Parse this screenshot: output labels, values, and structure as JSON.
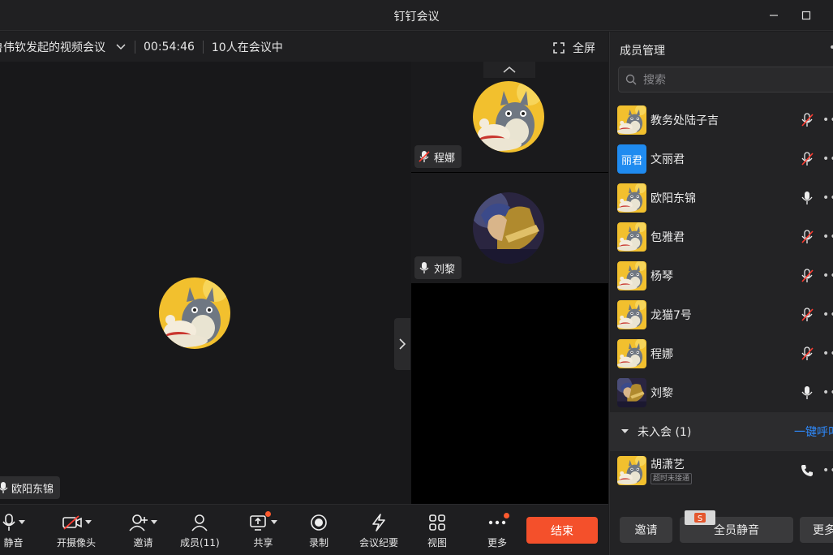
{
  "window": {
    "title": "钉钉会议"
  },
  "meeting": {
    "title": "鲁伟钦发起的视频会议",
    "duration": "00:54:46",
    "participants_status": "10人在会议中",
    "fullscreen_label": "全屏"
  },
  "stage": {
    "speaker_name": "欧阳东锦"
  },
  "gallery": [
    {
      "name": "程娜",
      "muted": true,
      "avatar": "totoro"
    },
    {
      "name": "刘黎",
      "muted": false,
      "avatar": "warrior"
    }
  ],
  "toolbar": {
    "mute_label": "静音",
    "camera_label": "开摄像头",
    "invite_label": "邀请",
    "members_label": "成员(11)",
    "share_label": "共享",
    "record_label": "录制",
    "minutes_label": "会议纪要",
    "view_label": "视图",
    "more_label": "更多",
    "end_label": "结束"
  },
  "panel": {
    "title": "成员管理",
    "more_glyph": "•",
    "search_placeholder": "搜索",
    "members": [
      {
        "name": "教务处陆子吉",
        "muted": true,
        "avatar": "totoro"
      },
      {
        "name": "文丽君",
        "muted": true,
        "avatar": "text",
        "avatar_text": "丽君"
      },
      {
        "name": "欧阳东锦",
        "muted": false,
        "avatar": "totoro"
      },
      {
        "name": "包雅君",
        "muted": true,
        "avatar": "totoro"
      },
      {
        "name": "杨琴",
        "muted": true,
        "avatar": "totoro"
      },
      {
        "name": "龙猫7号",
        "muted": true,
        "avatar": "totoro"
      },
      {
        "name": "程娜",
        "muted": true,
        "avatar": "totoro"
      },
      {
        "name": "刘黎",
        "muted": false,
        "avatar": "warrior"
      }
    ],
    "not_joined_label": "未入会 (1)",
    "call_all_label": "一键呼叫",
    "pending": [
      {
        "name": "胡潇艺",
        "status": "超时未接通",
        "avatar": "totoro"
      }
    ],
    "buttons": {
      "invite": "邀请",
      "mute_all": "全员静音",
      "more": "更多"
    }
  },
  "colors": {
    "accent": "#2e8bff",
    "end": "#f4502b",
    "mute_red": "#ff3b30",
    "avatar_bg": "#f1c232"
  }
}
